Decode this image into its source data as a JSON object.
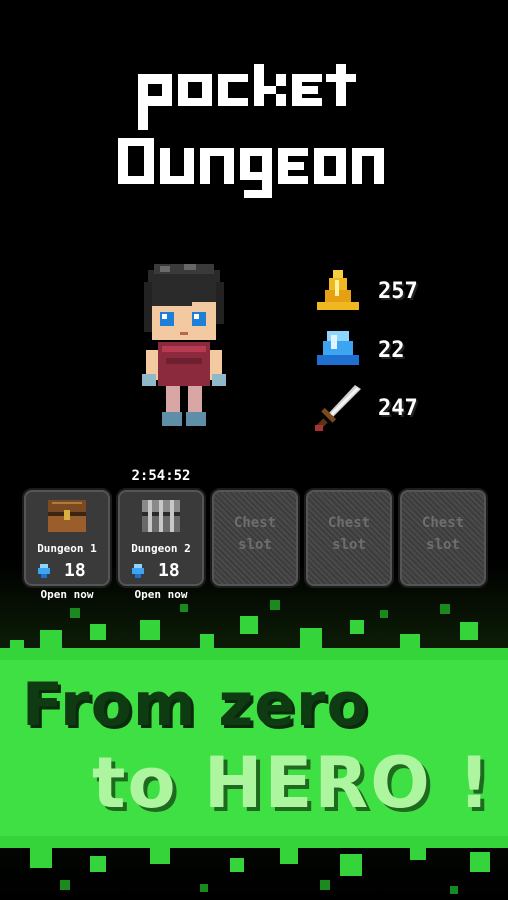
{
  "logo": {
    "line1": "pocket",
    "line2": "dungeon"
  },
  "hero": {
    "icon": "hero-character"
  },
  "resources": [
    {
      "icon": "gold-bell-icon",
      "value": "257",
      "color": "#f0b820"
    },
    {
      "icon": "gem-icon",
      "value": "22",
      "color": "#3da4f2"
    },
    {
      "icon": "sword-icon",
      "value": "247",
      "color": "#c9c9c9"
    }
  ],
  "timer": "2:54:52",
  "slots": [
    {
      "name": "Dungeon 1",
      "cost": "18",
      "status": "Open now",
      "chest": "wooden-chest-icon"
    },
    {
      "name": "Dungeon 2",
      "cost": "18",
      "status": "Open now",
      "chest": "iron-chest-icon"
    },
    {
      "empty_label": "Chest\nslot"
    },
    {
      "empty_label": "Chest\nslot"
    },
    {
      "empty_label": "Chest\nslot"
    }
  ],
  "tagline": {
    "line1": "From zero",
    "line2": "to HERO !"
  },
  "colors": {
    "banner_green": "#35d43a",
    "banner_dark": "#1a8a1f"
  }
}
